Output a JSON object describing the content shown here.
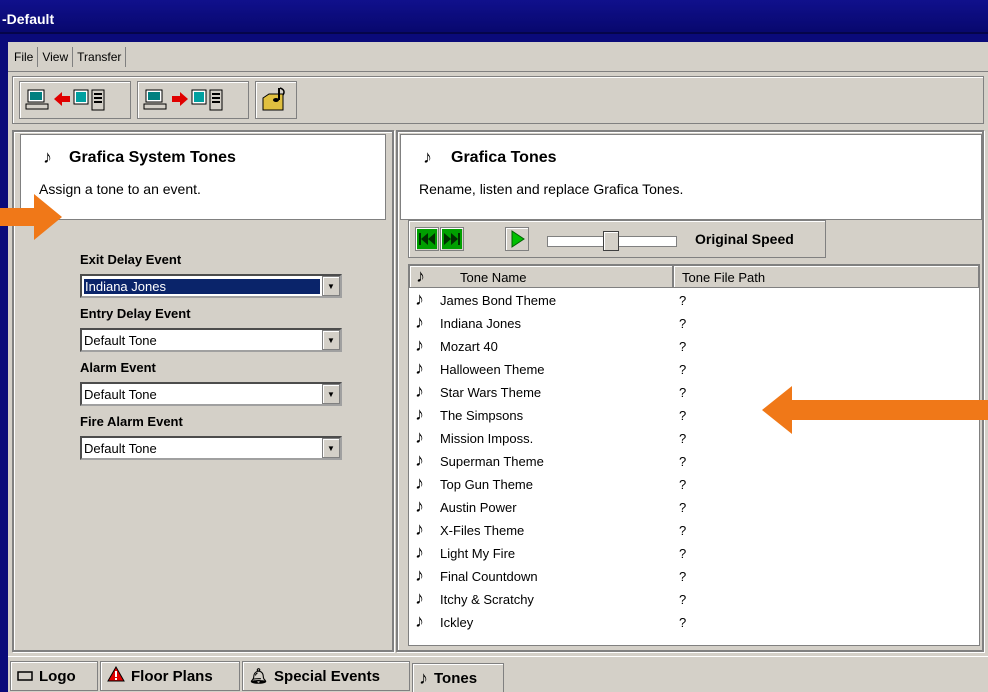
{
  "window": {
    "title": "-Default"
  },
  "menu": {
    "file": "File",
    "view": "View",
    "transfer": "Transfer"
  },
  "left": {
    "title": "Grafica System Tones",
    "description": "Assign a tone to an event.",
    "fields": [
      {
        "label": "Exit Delay Event",
        "value": "Indiana Jones"
      },
      {
        "label": "Entry Delay Event",
        "value": "Default Tone"
      },
      {
        "label": "Alarm Event",
        "value": "Default Tone"
      },
      {
        "label": "Fire Alarm Event",
        "value": "Default Tone"
      }
    ]
  },
  "right": {
    "title": "Grafica Tones",
    "description": "Rename, listen and replace Grafica Tones.",
    "speed_label": "Original Speed",
    "columns": {
      "name": "Tone Name",
      "path": "Tone File Path"
    },
    "tones": [
      {
        "name": "James Bond Theme",
        "path": "?"
      },
      {
        "name": "Indiana Jones",
        "path": "?"
      },
      {
        "name": "Mozart 40",
        "path": "?"
      },
      {
        "name": "Halloween Theme",
        "path": "?"
      },
      {
        "name": "Star Wars Theme",
        "path": "?"
      },
      {
        "name": "The Simpsons",
        "path": "?"
      },
      {
        "name": "Mission Imposs.",
        "path": "?"
      },
      {
        "name": "Superman Theme",
        "path": "?"
      },
      {
        "name": "Top Gun Theme",
        "path": "?"
      },
      {
        "name": "Austin Power",
        "path": "?"
      },
      {
        "name": "X-Files Theme",
        "path": "?"
      },
      {
        "name": "Light My Fire",
        "path": "?"
      },
      {
        "name": "Final Countdown",
        "path": "?"
      },
      {
        "name": "Itchy & Scratchy",
        "path": "?"
      },
      {
        "name": "Ickley",
        "path": "?"
      }
    ]
  },
  "tabs": [
    {
      "label": "Logo",
      "icon": "logo-icon"
    },
    {
      "label": "Floor Plans",
      "icon": "warning-icon"
    },
    {
      "label": "Special Events",
      "icon": "bell-icon"
    },
    {
      "label": "Tones",
      "icon": "music-note-icon"
    }
  ],
  "colors": {
    "annotation_arrow": "#f07818",
    "selection": "#0a246a"
  }
}
